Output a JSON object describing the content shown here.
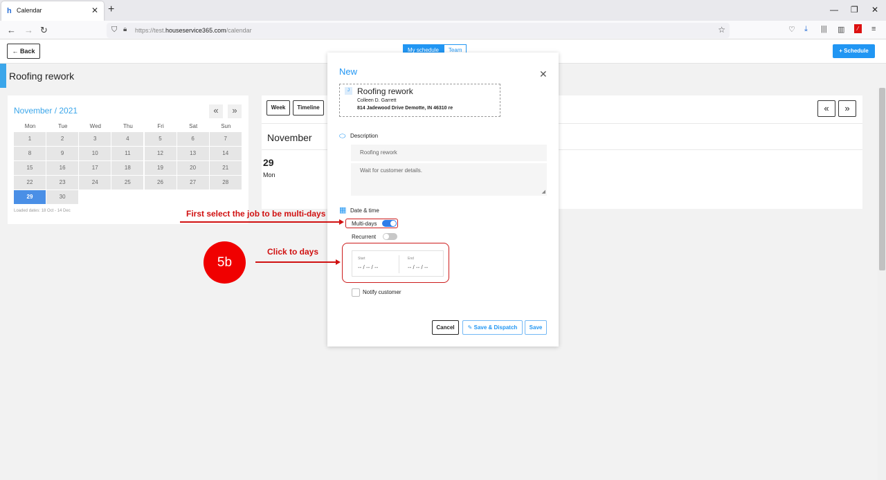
{
  "browser": {
    "tab_title": "Calendar",
    "url_prefix": "https://test.",
    "url_domain": "houseservice365.com",
    "url_path": "/calendar"
  },
  "header": {
    "back_label": "Back",
    "view_my_schedule": "My schedule",
    "view_team": "Team",
    "schedule_button": "+ Schedule"
  },
  "page_title": "Roofing rework",
  "mini_calendar": {
    "month_label": "November / 2021",
    "prev_label": "«",
    "next_label": "»",
    "weekdays": [
      "Mon",
      "Tue",
      "Wed",
      "Thu",
      "Fri",
      "Sat",
      "Sun"
    ],
    "weeks": [
      [
        "1",
        "2",
        "3",
        "4",
        "5",
        "6",
        "7"
      ],
      [
        "8",
        "9",
        "10",
        "11",
        "12",
        "13",
        "14"
      ],
      [
        "15",
        "16",
        "17",
        "18",
        "19",
        "20",
        "21"
      ],
      [
        "22",
        "23",
        "24",
        "25",
        "26",
        "27",
        "28"
      ],
      [
        "29",
        "30"
      ]
    ],
    "selected_day": "29",
    "loaded_dates": "Loaded dates: 18 Oct - 14 Dec"
  },
  "week_panel": {
    "week_label": "Week",
    "timeline_label": "Timeline",
    "month": "November",
    "day_number": "29",
    "day_name": "Mon"
  },
  "modal": {
    "title": "New",
    "job_name": "Roofing rework",
    "customer": "Colleen D. Garrett",
    "address": "814 Jadewood Drive Demotte, IN 46310 re",
    "description_label": "Description",
    "description_value": "Roofing rework",
    "notes_value": "Wait for customer details.",
    "datetime_label": "Date & time",
    "multidays_label": "Multi-days",
    "multidays_on": true,
    "recurrent_label": "Recurrent",
    "recurrent_on": false,
    "start_label": "Start",
    "start_value": "-- / -- / --",
    "end_label": "End",
    "end_value": "-- / -- / --",
    "notify_label": "Notify customer",
    "cancel_label": "Cancel",
    "save_dispatch_label": "Save & Dispatch",
    "save_label": "Save"
  },
  "annotations": {
    "step_badge": "5b",
    "note_multidays": "First select the job to be multi-days",
    "note_click_days": "Click to days"
  },
  "colors": {
    "primary": "#2196f3",
    "accent_bar": "#3ba6ea",
    "annotation_red": "#d01010",
    "selected_day": "#4a8fe6"
  }
}
